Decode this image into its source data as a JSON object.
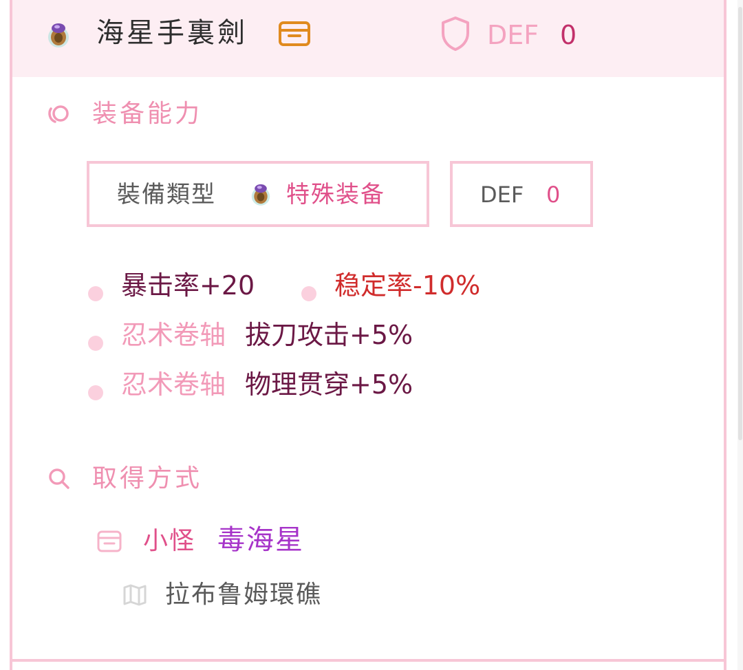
{
  "header": {
    "item_name": "海星手裏劍",
    "def_label": "DEF",
    "def_value": "0"
  },
  "abilities": {
    "section_title": "装备能力",
    "equip_type_label": "裝備類型",
    "equip_type_value": "特殊装备",
    "def_label": "DEF",
    "def_value": "0",
    "stats": [
      {
        "text": "暴击率+20"
      },
      {
        "text": "稳定率-10%"
      }
    ],
    "scrolls": [
      {
        "prefix": "忍术卷轴",
        "text": "拔刀攻击+5%"
      },
      {
        "prefix": "忍术卷轴",
        "text": "物理贯穿+5%"
      }
    ]
  },
  "acquire": {
    "section_title": "取得方式",
    "source_type": "小怪",
    "source_name": "毒海星",
    "location": "拉布鲁姆環礁"
  },
  "colors": {
    "accent": "#f7c6d6",
    "header_bg": "#fdeef3",
    "pink_text": "#f29ab8",
    "stat_dark": "#6b1845",
    "stat_negative": "#d02c2c",
    "monster": "#a633c9"
  },
  "icons": {
    "item": "ring-icon",
    "drop_badge": "card-icon",
    "def": "shield-icon",
    "abilities": "swirl-icon",
    "acquire": "search-icon",
    "location": "map-icon"
  }
}
